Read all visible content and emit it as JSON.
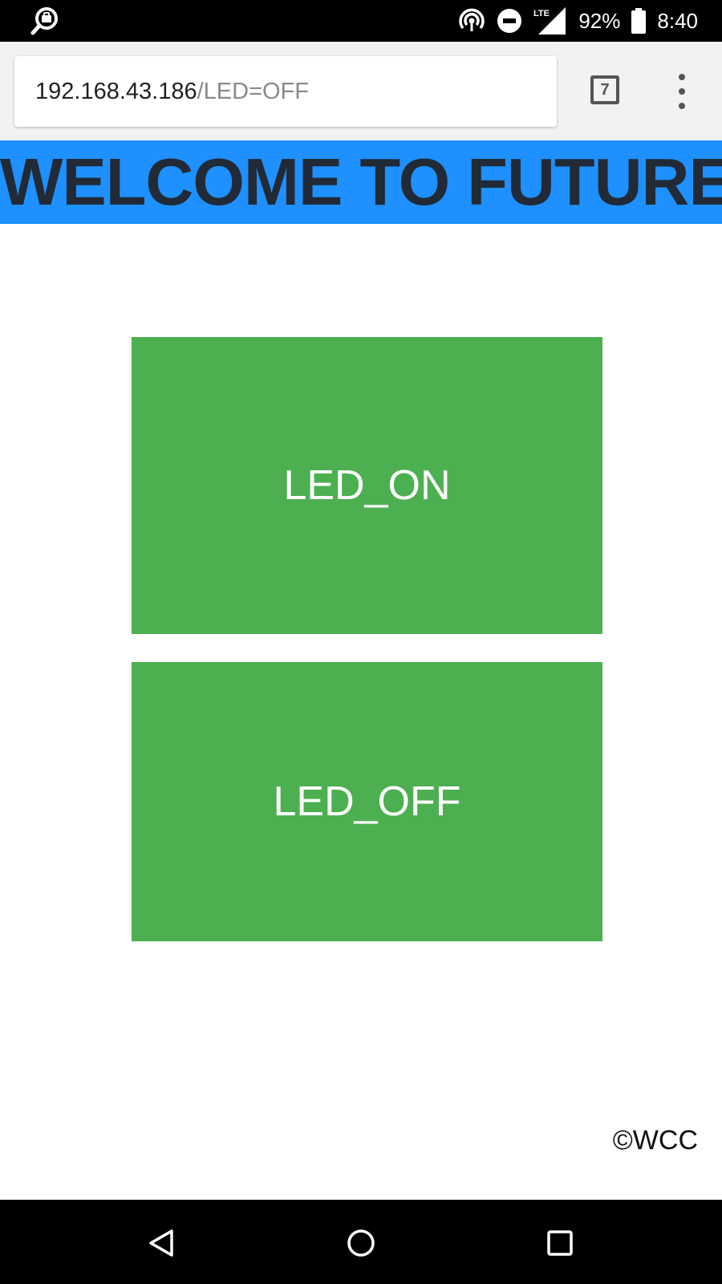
{
  "status_bar": {
    "battery_percent": "92%",
    "time": "8:40",
    "network": "LTE",
    "icons": [
      "notification-search-icon",
      "hotspot-icon",
      "do-not-disturb-icon",
      "lte-signal-icon",
      "battery-icon"
    ]
  },
  "browser": {
    "url_host": "192.168.43.186",
    "url_path": "/LED=OFF",
    "tab_count": "7",
    "menu_icon": "more-vert-icon"
  },
  "page": {
    "heading": "WELCOME TO FUTURE",
    "buttons": [
      {
        "label": "LED_ON"
      },
      {
        "label": "LED_OFF"
      }
    ],
    "footer": "©WCC",
    "colors": {
      "banner": "#1e90ff",
      "button": "#4caf50"
    }
  },
  "nav_bar": {
    "icons": [
      "back-icon",
      "home-icon",
      "recents-icon"
    ]
  }
}
